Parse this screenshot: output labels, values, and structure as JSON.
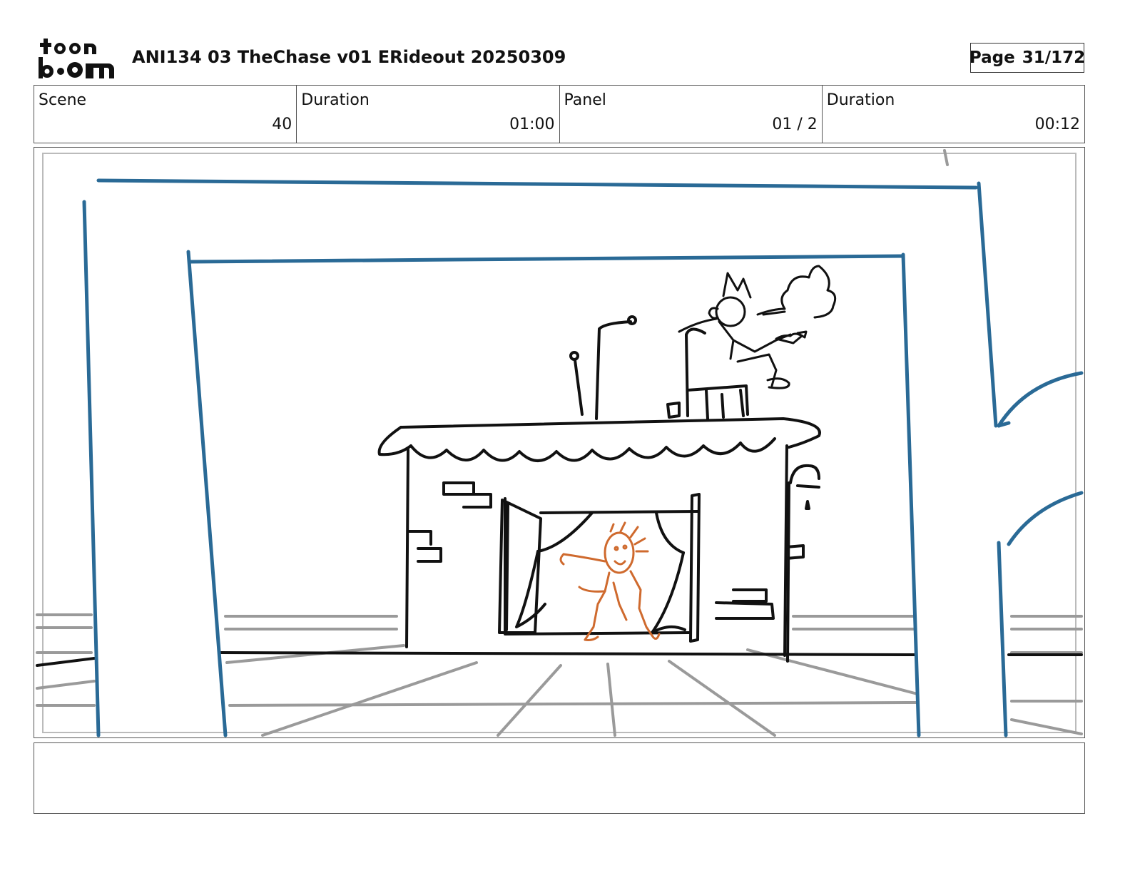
{
  "header": {
    "logo_text": "toonboom",
    "title": "ANI134 03 TheChase v01 ERideout 20250309",
    "page_label": "Page",
    "page_value": "31/172"
  },
  "info": {
    "scene_label": "Scene",
    "scene_value": "40",
    "scene_duration_label": "Duration",
    "scene_duration_value": "01:00",
    "panel_label": "Panel",
    "panel_value": "01 / 2",
    "panel_duration_label": "Duration",
    "panel_duration_value": "00:12"
  },
  "panel": {
    "colors": {
      "camera_frame": "#2a6a96",
      "ink": "#111111",
      "character_sketch": "#cf6a2e",
      "floor_lines": "#9a9a9a"
    }
  },
  "notes": {
    "text": ""
  }
}
